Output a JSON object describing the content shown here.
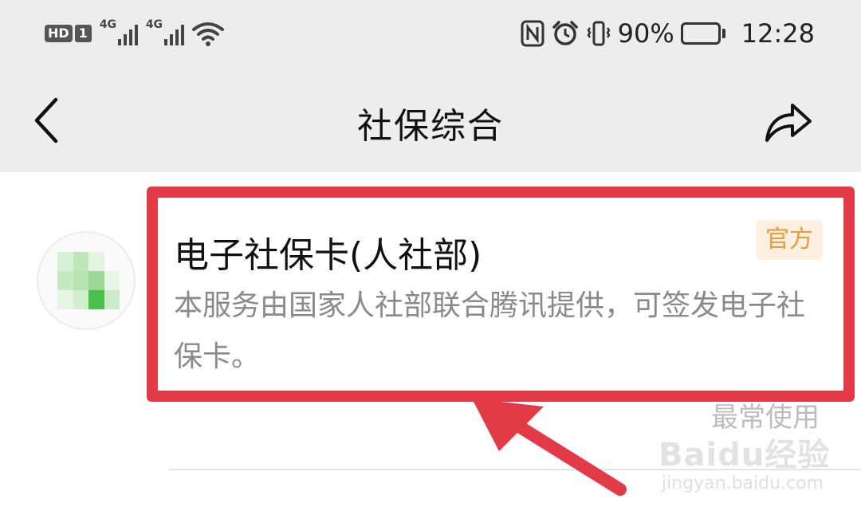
{
  "status_bar": {
    "hd_label": "HD",
    "sim_label": "1",
    "network_1": "4G",
    "network_2": "4G",
    "battery_percent": "90%",
    "battery_level": 0.9,
    "time": "12:28",
    "icons": [
      "hd-icon",
      "signal-icon",
      "signal-icon",
      "wifi-icon",
      "nfc-icon",
      "alarm-icon",
      "vibrate-icon",
      "battery-icon"
    ]
  },
  "header": {
    "title": "社保综合",
    "back_icon": "chevron-left-icon",
    "share_icon": "share-icon"
  },
  "service": {
    "name": "电子社保卡(人社部)",
    "badge": "官方",
    "description": "本服务由国家人社部联合腾讯提供，可签发电子社保卡。",
    "avatar_icon": "service-logo-mosaic"
  },
  "section_label": "最常使用",
  "watermark": {
    "logo_text": "Baidu经验",
    "url": "jingyan.baidu.com"
  },
  "colors": {
    "highlight": "#e33a48",
    "badge_bg": "#fdf0e1",
    "badge_text": "#ea9b3c",
    "header_bg": "#ededed"
  }
}
